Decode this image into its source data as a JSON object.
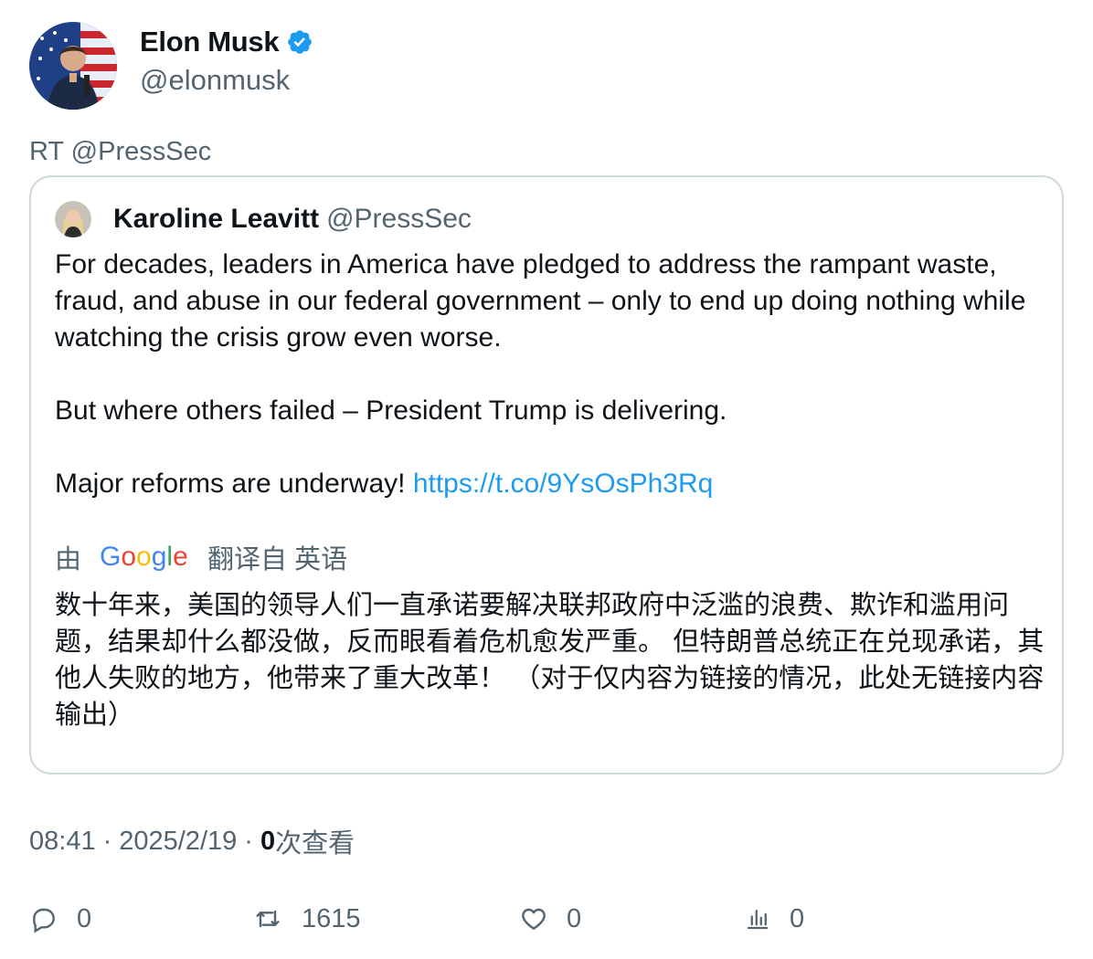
{
  "author": {
    "name": "Elon Musk",
    "handle": "@elonmusk",
    "verified": true,
    "avatar_icon": "avatar-photo"
  },
  "retweet_line": "RT @PressSec",
  "quoted": {
    "name": "Karoline Leavitt",
    "handle": "@PressSec",
    "paragraphs": [
      "For decades, leaders in America have pledged to address the rampant waste, fraud, and abuse in our federal government – only to end up doing nothing while watching the crisis grow even worse.",
      "But where others failed – President Trump is delivering.",
      "Major reforms are underway! "
    ],
    "link": "https://t.co/9YsOsPh3Rq",
    "translation": {
      "prefix": "由",
      "provider": "Google",
      "suffix": "翻译自 英语",
      "text": "数十年来，美国的领导人们一直承诺要解决联邦政府中泛滥的浪费、欺诈和滥用问题，结果却什么都没做，反而眼看着危机愈发严重。 但特朗普总统正在兑现承诺，其他人失败的地方，他带来了重大改革！ （对于仅内容为链接的情况，此处无链接内容输出）"
    }
  },
  "meta": {
    "time": "08:41",
    "separator": "·",
    "date": "2025/2/19",
    "views_count": "0",
    "views_label": "次查看"
  },
  "actions": {
    "reply_count": "0",
    "retweet_count": "1615",
    "like_count": "0",
    "views_count": "0"
  },
  "colors": {
    "text": "#0f1419",
    "secondary": "#536471",
    "link": "#1d9bf0",
    "verified": "#1d9bf0",
    "border": "#cfd9de"
  }
}
